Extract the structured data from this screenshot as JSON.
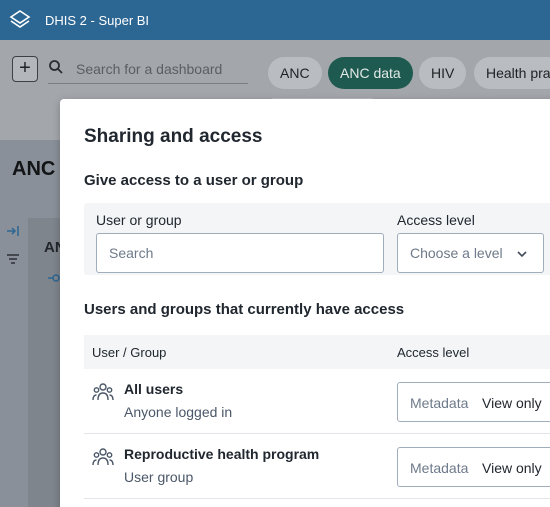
{
  "header": {
    "app_title": "DHIS 2 - Super BI"
  },
  "dashboard_bar": {
    "add_label": "+",
    "search_placeholder": "Search for a dashboard",
    "chips": [
      "ANC",
      "ANC data",
      "HIV",
      "Health pra"
    ]
  },
  "page": {
    "title": "ANC",
    "panel_title": "AN"
  },
  "modal": {
    "title": "Sharing and access",
    "give_access": {
      "heading": "Give access to a user or group",
      "user_group_label": "User or group",
      "search_placeholder": "Search",
      "access_level_label": "Access level",
      "access_level_placeholder": "Choose a level"
    },
    "current_access": {
      "heading": "Users and groups that currently have access",
      "col_user_group": "User / Group",
      "col_access_level": "Access level",
      "rows": [
        {
          "name": "All users",
          "subtitle": "Anyone logged in",
          "metadata_label": "Metadata",
          "access_value": "View only"
        },
        {
          "name": "Reproductive health program",
          "subtitle": "User group",
          "metadata_label": "Metadata",
          "access_value": "View only"
        }
      ]
    }
  },
  "colors": {
    "header": "#2c6693",
    "active_chip": "#1e5a4f",
    "modal_bg": "#ffffff"
  },
  "icons": [
    "dhis2-logo-icon",
    "search-icon",
    "collapse-icon",
    "filter-icon",
    "users-group-icon",
    "chevron-down-icon"
  ]
}
